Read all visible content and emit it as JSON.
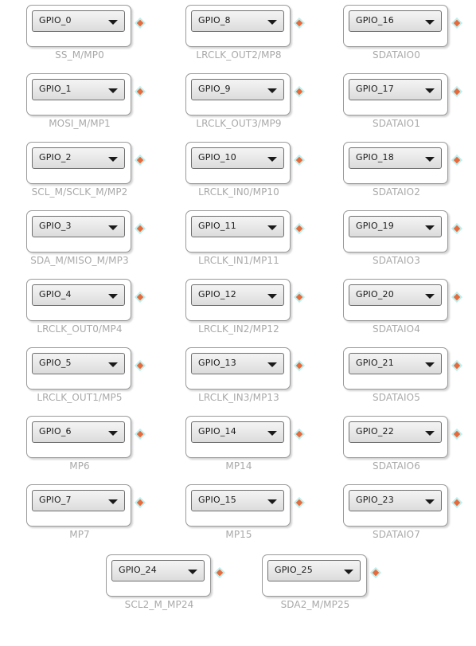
{
  "blocks": [
    {
      "value": "GPIO_0",
      "caption": "SS_M/MP0"
    },
    {
      "value": "GPIO_1",
      "caption": "MOSI_M/MP1"
    },
    {
      "value": "GPIO_2",
      "caption": "SCL_M/SCLK_M/MP2"
    },
    {
      "value": "GPIO_3",
      "caption": "SDA_M/MISO_M/MP3"
    },
    {
      "value": "GPIO_4",
      "caption": "LRCLK_OUT0/MP4"
    },
    {
      "value": "GPIO_5",
      "caption": "LRCLK_OUT1/MP5"
    },
    {
      "value": "GPIO_6",
      "caption": "MP6"
    },
    {
      "value": "GPIO_7",
      "caption": "MP7"
    },
    {
      "value": "GPIO_8",
      "caption": "LRCLK_OUT2/MP8"
    },
    {
      "value": "GPIO_9",
      "caption": "LRCLK_OUT3/MP9"
    },
    {
      "value": "GPIO_10",
      "caption": "LRCLK_IN0/MP10"
    },
    {
      "value": "GPIO_11",
      "caption": "LRCLK_IN1/MP11"
    },
    {
      "value": "GPIO_12",
      "caption": "LRCLK_IN2/MP12"
    },
    {
      "value": "GPIO_13",
      "caption": "LRCLK_IN3/MP13"
    },
    {
      "value": "GPIO_14",
      "caption": "MP14"
    },
    {
      "value": "GPIO_15",
      "caption": "MP15"
    },
    {
      "value": "GPIO_16",
      "caption": "SDATAIO0"
    },
    {
      "value": "GPIO_17",
      "caption": "SDATAIO1"
    },
    {
      "value": "GPIO_18",
      "caption": "SDATAIO2"
    },
    {
      "value": "GPIO_19",
      "caption": "SDATAIO3"
    },
    {
      "value": "GPIO_20",
      "caption": "SDATAIO4"
    },
    {
      "value": "GPIO_21",
      "caption": "SDATAIO5"
    },
    {
      "value": "GPIO_22",
      "caption": "SDATAIO6"
    },
    {
      "value": "GPIO_23",
      "caption": "SDATAIO7"
    },
    {
      "value": "GPIO_24",
      "caption": "SCL2_M_MP24"
    },
    {
      "value": "GPIO_25",
      "caption": "SDA2_M/MP25"
    }
  ],
  "colors": {
    "pin_outer": "#bfeeee",
    "pin_inner": "#e86a3a",
    "caption_text": "#a9a9a9",
    "block_border": "#9a9a9a"
  },
  "icons": {
    "dropdown": "chevron-down-icon",
    "pin": "output-pin-icon"
  }
}
